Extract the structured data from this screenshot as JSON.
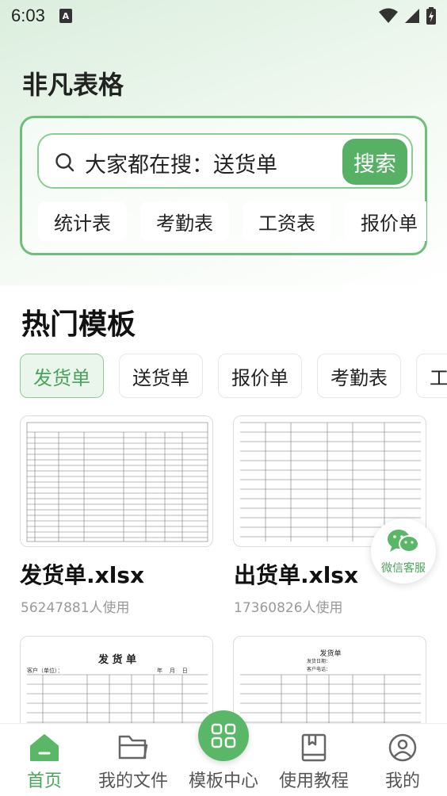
{
  "status_bar": {
    "time": "6:03",
    "notification_letter": "A"
  },
  "app_title": "非凡表格",
  "search": {
    "placeholder": "大家都在搜：送货单",
    "button_label": "搜索"
  },
  "quick_tags": [
    "统计表",
    "考勤表",
    "工资表",
    "报价单"
  ],
  "section_title": "热门模板",
  "filters": [
    "发货单",
    "送货单",
    "报价单",
    "考勤表",
    "工"
  ],
  "cards": [
    {
      "title": "发货单.xlsx",
      "usage": "56247881人使用"
    },
    {
      "title": "出货单.xlsx",
      "usage": "17360826人使用"
    }
  ],
  "preview_cards": [
    {
      "heading": "发 货 单",
      "line1": "客户（单位）：",
      "line2": "年    月    日"
    },
    {
      "heading": "发货单",
      "line1": "发货日期：",
      "line2": "客户电话："
    }
  ],
  "wechat_service": "微信客服",
  "bottom_nav": [
    {
      "label": "首页",
      "icon": "home-icon"
    },
    {
      "label": "我的文件",
      "icon": "folder-icon"
    },
    {
      "label": "模板中心",
      "icon": "grid-icon"
    },
    {
      "label": "使用教程",
      "icon": "book-icon"
    },
    {
      "label": "我的",
      "icon": "user-icon"
    }
  ],
  "colors": {
    "accent": "#56b165",
    "accent_light": "#eaf6ec",
    "muted": "#999999"
  }
}
